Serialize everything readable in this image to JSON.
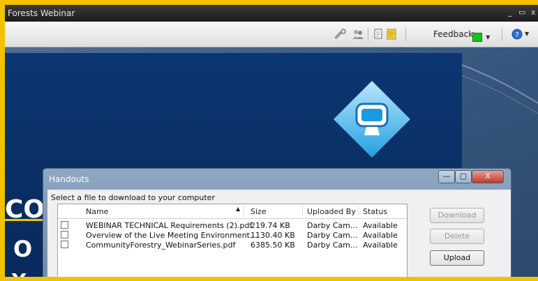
{
  "window": {
    "title": "Forests Webinar",
    "minimize": "_",
    "restore": "▭",
    "close": "x"
  },
  "toolbar": {
    "feedback_label": "Feedback:",
    "feedback_color": "#17c217",
    "icons": [
      "tools-icon",
      "people-icon",
      "handout-icon",
      "notes-icon",
      "help-icon"
    ]
  },
  "slide": {
    "text_1": "CO",
    "text_2": "O",
    "text_3": "Y"
  },
  "handouts": {
    "title": "Handouts",
    "minimize": "—",
    "maximize": "▢",
    "close": "X",
    "instruction": "Select a file to download to your computer",
    "columns": {
      "name": "Name",
      "size": "Size",
      "uploaded_by": "Uploaded By",
      "status": "Status"
    },
    "rows": [
      {
        "name": "WEBINAR TECHNICAL Requirements (2).pdf",
        "size": "219.74 KB",
        "uploaded_by": "Darby Cam...",
        "status": "Available"
      },
      {
        "name": "Overview of the Live Meeting Environment...",
        "size": "1130.40 KB",
        "uploaded_by": "Darby Cam...",
        "status": "Available"
      },
      {
        "name": "CommunityForestry_WebinarSeries.pdf",
        "size": "6385.50 KB",
        "uploaded_by": "Darby Cam...",
        "status": "Available"
      }
    ],
    "buttons": {
      "download": "Download",
      "delete": "Delete",
      "upload": "Upload"
    }
  }
}
